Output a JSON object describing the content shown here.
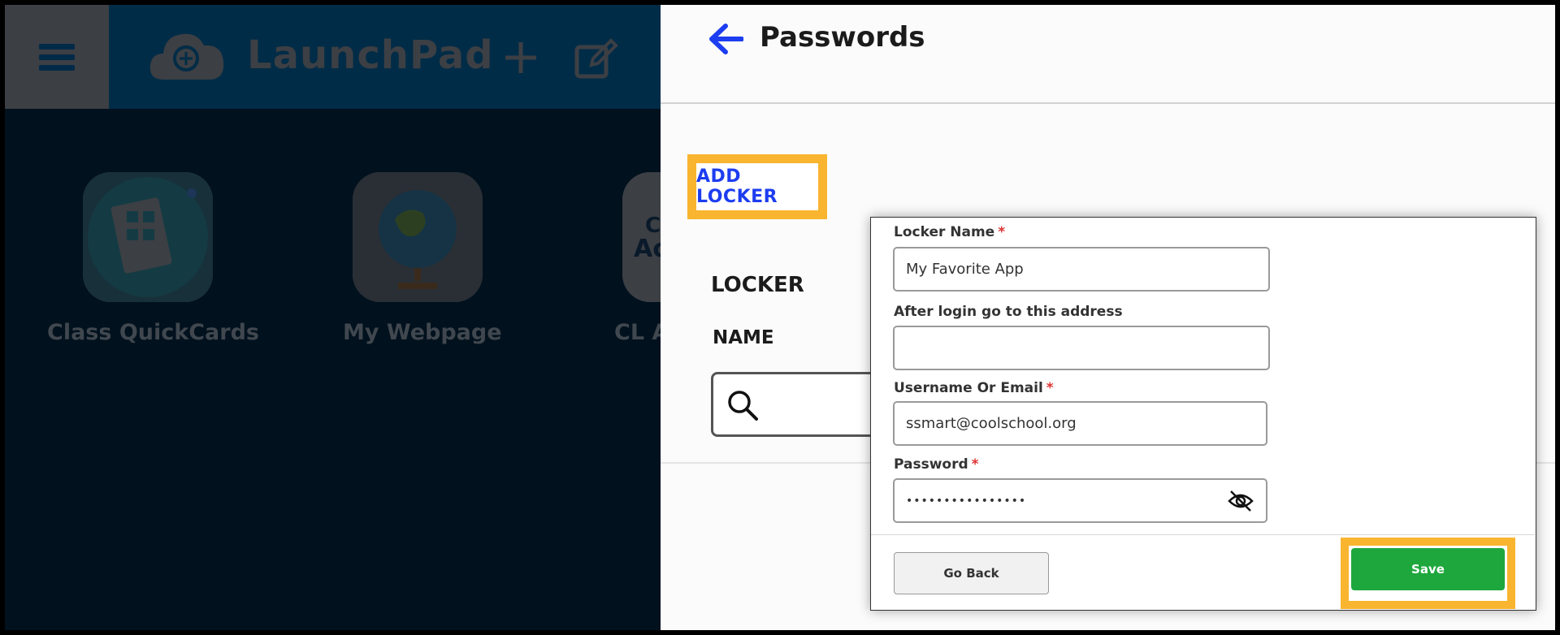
{
  "app": {
    "title": "LaunchPad",
    "tiles": [
      {
        "label": "Class QuickCards",
        "icon": "quickcards-icon"
      },
      {
        "label": "My Webpage",
        "icon": "globe-icon"
      },
      {
        "label": "CL A",
        "icon": "cl-app-icon"
      }
    ],
    "tile_partial_text": "Cl\nAc"
  },
  "panel": {
    "title": "Passwords",
    "add_locker_label": "ADD LOCKER",
    "locker_heading": "LOCKER",
    "name_heading": "NAME"
  },
  "dialog": {
    "locker_name_label": "Locker Name",
    "locker_name_value": "My Favorite App",
    "after_login_label": "After login go to this address",
    "after_login_value": "",
    "username_label": "Username Or Email",
    "username_value": "ssmart@coolschool.org",
    "password_label": "Password",
    "password_value": "••••••••••••••••",
    "required_marker": "*",
    "go_back_label": "Go Back",
    "save_label": "Save"
  },
  "colors": {
    "highlight": "#f9b52f",
    "accent_blue": "#1d3df0",
    "save_green": "#1ea73d",
    "required_red": "#d33333"
  }
}
